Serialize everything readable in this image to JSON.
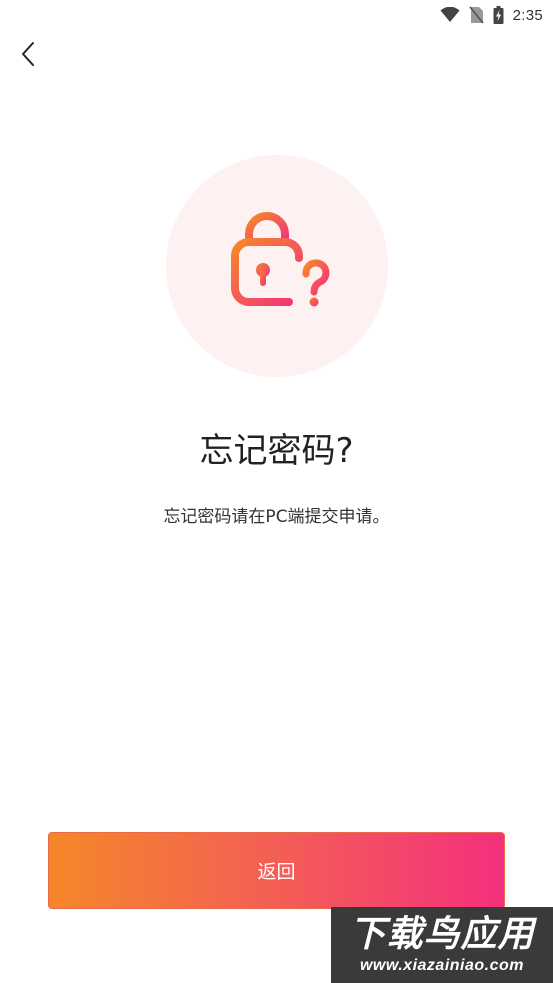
{
  "status_bar": {
    "time": "2:35",
    "icons": [
      "wifi-icon",
      "no-sim-icon",
      "battery-charging-icon"
    ]
  },
  "header": {
    "back_icon": "chevron-left-icon"
  },
  "illustration": {
    "icon": "lock-question-icon",
    "circle_color": "#fdf1f1",
    "gradient_start": "#f5872a",
    "gradient_end": "#f4307e"
  },
  "content": {
    "title": "忘记密码?",
    "description": "忘记密码请在PC端提交申请。"
  },
  "footer": {
    "return_label": "返回"
  },
  "watermark": {
    "text": "下载鸟应用",
    "url": "www.xiazainiao.com"
  }
}
